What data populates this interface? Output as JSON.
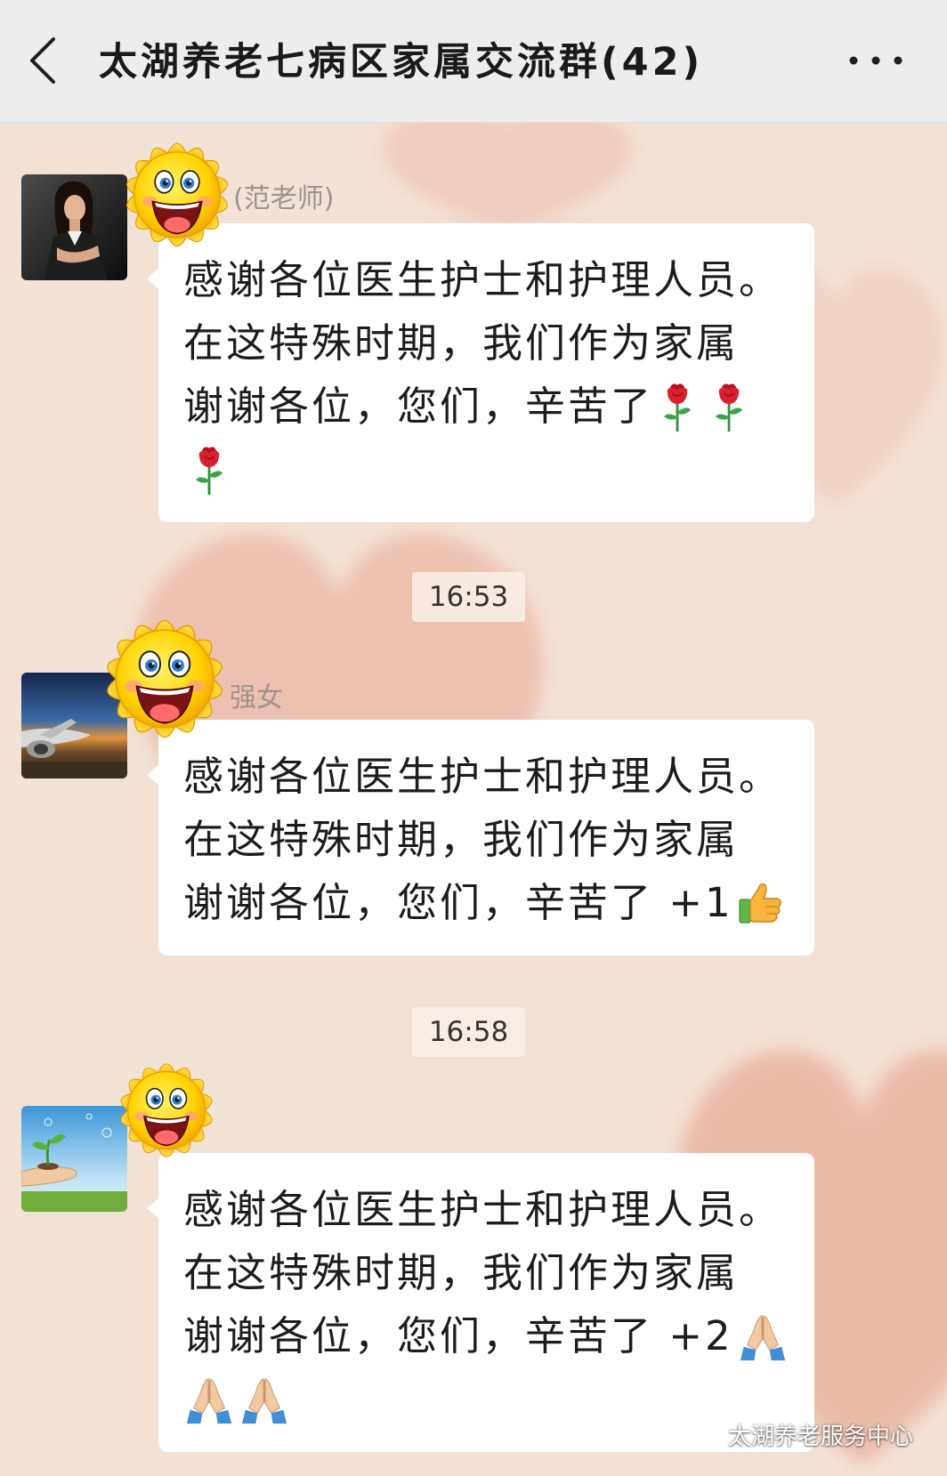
{
  "header": {
    "back_icon": "chevron-left-icon",
    "title": "太湖养老七病区家属交流群(42)",
    "more_icon": "more-icon"
  },
  "messages": [
    {
      "sender": "(范老师)",
      "avatar_icon": "woman-portrait-avatar",
      "sticker_icon": "sun-smiley-sticker",
      "lines": [
        {
          "text": "感谢各位医生护士和护理人员。",
          "icons": []
        },
        {
          "text": "在这特殊时期，我们作为家属",
          "icons": []
        },
        {
          "text": "谢谢各位，您们，辛苦了",
          "icons": [
            "rose-icon",
            "rose-icon"
          ]
        },
        {
          "icons": [
            "rose-icon"
          ]
        }
      ]
    },
    {
      "timestamp": "16:53",
      "sender": "强女",
      "avatar_icon": "airplane-photo-avatar",
      "sticker_icon": "sun-smiley-sticker",
      "lines": [
        {
          "text": "感谢各位医生护士和护理人员。",
          "icons": []
        },
        {
          "text": "在这特殊时期，我们作为家属",
          "icons": []
        },
        {
          "text": "谢谢各位，您们，辛苦了 +1",
          "icons": [
            "thumbs-up-icon"
          ]
        }
      ]
    },
    {
      "timestamp": "16:58",
      "avatar_icon": "sprout-in-hand-avatar",
      "sticker_icon": "sun-smiley-sticker",
      "lines": [
        {
          "text": "感谢各位医生护士和护理人员。",
          "icons": []
        },
        {
          "text": "在这特殊时期，我们作为家属",
          "icons": []
        },
        {
          "text": "谢谢各位，您们，辛苦了 +2",
          "icons": [
            "pray-icon"
          ]
        },
        {
          "icons": [
            "pray-icon",
            "pray-icon"
          ]
        }
      ]
    }
  ],
  "watermark": {
    "icon": "wechat-icon",
    "text": "太湖养老服务中心"
  },
  "colors": {
    "background": "#f2e2d6",
    "header": "#ededed",
    "bubble": "#ffffff",
    "heart": "#e59a86"
  }
}
